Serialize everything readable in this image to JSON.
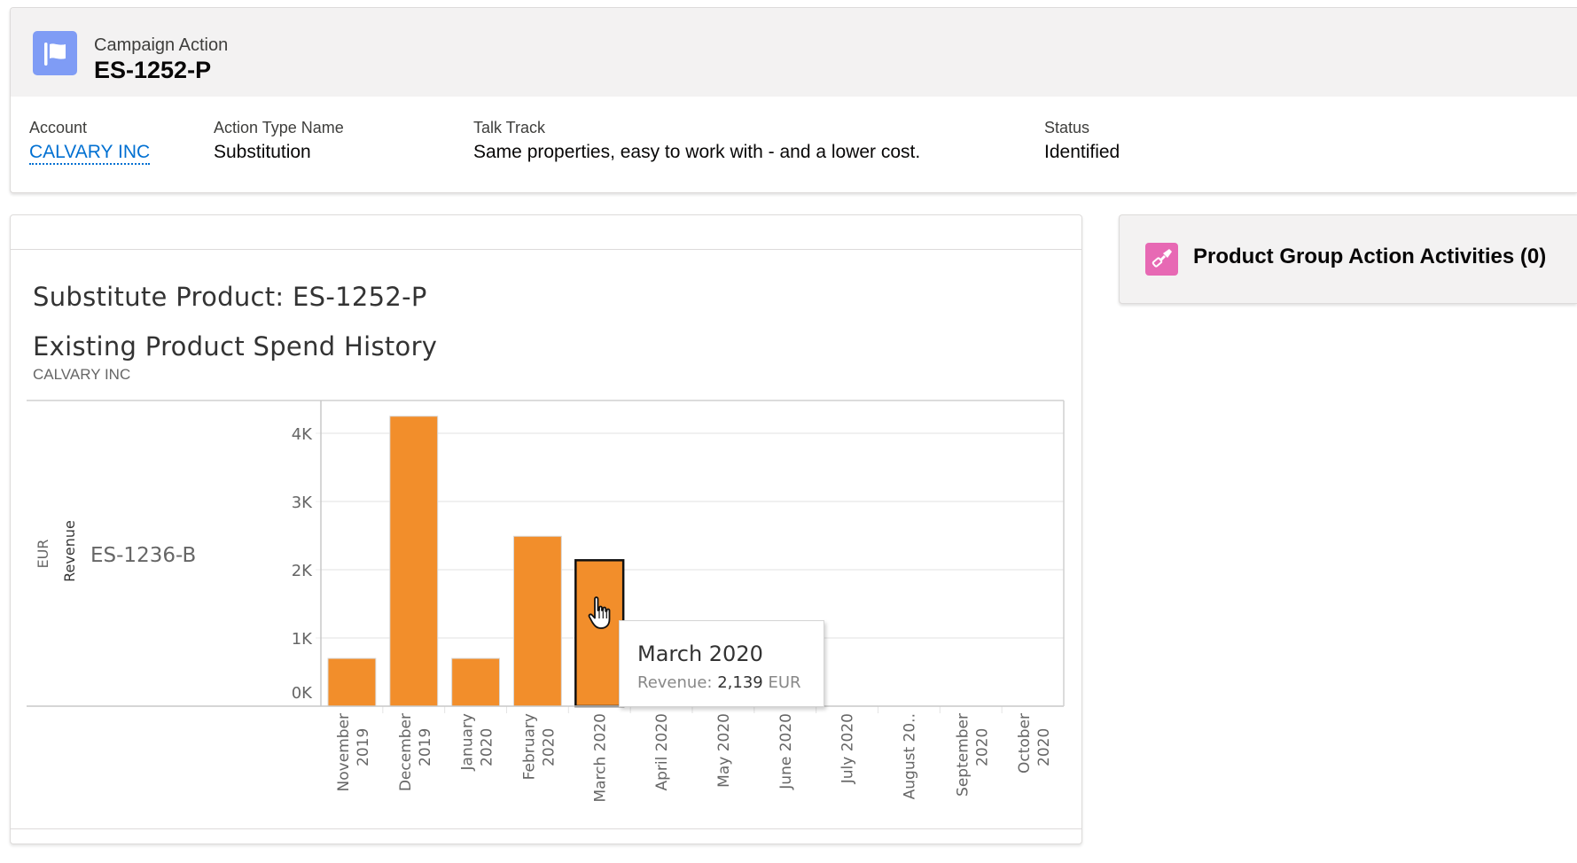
{
  "record": {
    "object_type": "Campaign Action",
    "name": "ES-1252-P",
    "icon": "flag-icon",
    "icon_color": "#7f9cf5"
  },
  "fields": [
    {
      "label": "Account",
      "value": "CALVARY INC",
      "is_link": true
    },
    {
      "label": "Action Type Name",
      "value": "Substitution",
      "is_link": false
    },
    {
      "label": "Talk Track",
      "value": "Same properties, easy to work with - and a lower cost.",
      "is_link": false
    },
    {
      "label": "Status",
      "value": "Identified",
      "is_link": false
    }
  ],
  "panel": {
    "substitute_title": "Substitute Product: ES-1252-P",
    "spend_title": "Existing Product Spend History",
    "spend_subtitle": "CALVARY INC"
  },
  "related": {
    "title": "Product Group Action Activities (0)",
    "icon": "flashlight-icon",
    "icon_color": "#e769b4"
  },
  "tooltip": {
    "title": "March 2020",
    "label": "Revenue: ",
    "value": "2,139",
    "unit": " EUR"
  },
  "chart_data": {
    "type": "bar",
    "title": "Existing Product Spend History",
    "subtitle": "CALVARY INC",
    "row_header": "ES-1236-B",
    "ylabel": "Revenue",
    "ylabel_unit": "EUR",
    "xlabel": "",
    "ylim": [
      0,
      4400
    ],
    "yticks": [
      0,
      1000,
      2000,
      3000,
      4000
    ],
    "ytick_labels": [
      "0K",
      "1K",
      "2K",
      "3K",
      "4K"
    ],
    "grid": true,
    "bar_color": "#f28e2b",
    "highlighted_category": "March 2020",
    "categories": [
      [
        "November",
        "2019"
      ],
      [
        "December",
        "2019"
      ],
      [
        "January",
        "2020"
      ],
      [
        "February",
        "2020"
      ],
      [
        "March 2020"
      ],
      [
        "April 2020"
      ],
      [
        "May 2020"
      ],
      [
        "June 2020"
      ],
      [
        "July 2020"
      ],
      [
        "August 20.."
      ],
      [
        "September",
        "2020"
      ],
      [
        "October",
        "2020"
      ]
    ],
    "values": [
      700,
      4250,
      700,
      2490,
      2139,
      null,
      null,
      null,
      null,
      null,
      null,
      null
    ]
  }
}
